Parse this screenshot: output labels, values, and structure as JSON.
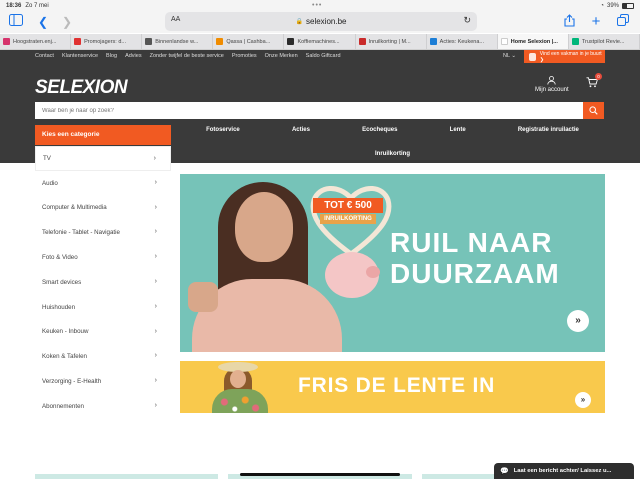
{
  "status_bar": {
    "time": "18:36",
    "date": "Zo 7 mei",
    "battery": "39%"
  },
  "browser": {
    "aa_label": "AA",
    "url": "selexion.be",
    "tabs": [
      {
        "label": "Hoogstraten.enj...",
        "color": "#d6336c",
        "active": false
      },
      {
        "label": "Promojagers: d...",
        "color": "#e03131",
        "active": false
      },
      {
        "label": "Binnenlandse w...",
        "color": "#555555",
        "active": false
      },
      {
        "label": "Qassa | Cashba...",
        "color": "#f08c00",
        "active": false
      },
      {
        "label": "Koffiemachines...",
        "color": "#2b2b2b",
        "active": false
      },
      {
        "label": "Inruilkorting | M...",
        "color": "#c92a2a",
        "active": false
      },
      {
        "label": "Acties: Keukena...",
        "color": "#1c7ed6",
        "active": false
      },
      {
        "label": "Home Selexion |...",
        "color": "#ffffff",
        "active": true
      },
      {
        "label": "Trustpilot Revie...",
        "color": "#00b67a",
        "active": false
      }
    ]
  },
  "topnav": {
    "links": [
      "Contact",
      "Klantenservice",
      "Blog",
      "Advies",
      "Zonder twijfel de beste service",
      "Promoties",
      "Onze Merken",
      "Saldo Giftcard"
    ],
    "lang": "NL ⌄",
    "vakman": "Vind een vakman in je buurt ❯"
  },
  "header": {
    "logo": "SELEXION",
    "account": "Mijn account",
    "cart_count": "0",
    "search_placeholder": "Waar ben je naar op zoek?",
    "category_button": "Kies een categorie",
    "menu_row1": [
      "Fotoservice",
      "Acties",
      "Ecocheques",
      "Lente",
      "Registratie inruilactie"
    ],
    "menu_row2": "Inruilkorting"
  },
  "categories": [
    "TV",
    "Audio",
    "Computer & Multimedia",
    "Telefonie - Tablet - Navigatie",
    "Foto & Video",
    "Smart devices",
    "Huishouden",
    "Keuken - Inbouw",
    "Koken & Tafelen",
    "Verzorging - E-Health",
    "Abonnementen"
  ],
  "banner1": {
    "promo": "TOT € 500",
    "promo_sub": "INRUILKORTING",
    "title": "RUIL NAAR DUURZAAM",
    "arrow": "»"
  },
  "banner2": {
    "title": "FRIS DE LENTE IN",
    "arrow": "»"
  },
  "chat": {
    "label": "Laat een bericht achter/ Laissez u..."
  }
}
